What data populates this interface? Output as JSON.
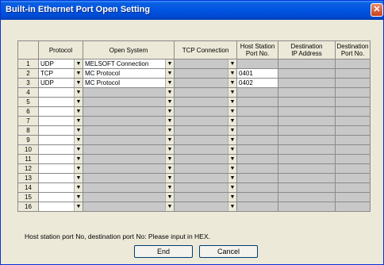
{
  "window": {
    "title": "Built-in Ethernet Port Open Setting"
  },
  "columns": {
    "protocol": "Protocol",
    "open_system": "Open System",
    "tcp_connection": "TCP Connection",
    "host_station_port": "Host Station\nPort No.",
    "dest_ip": "Destination\nIP Address",
    "dest_port": "Destination\nPort No."
  },
  "rows": [
    {
      "num": "1",
      "protocol": "UDP",
      "open_system": "MELSOFT Connection",
      "tcp": "",
      "host_port": "",
      "dest_ip": "",
      "dest_port": ""
    },
    {
      "num": "2",
      "protocol": "TCP",
      "open_system": "MC Protocol",
      "tcp": "",
      "host_port": "0401",
      "dest_ip": "",
      "dest_port": ""
    },
    {
      "num": "3",
      "protocol": "UDP",
      "open_system": "MC Protocol",
      "tcp": "",
      "host_port": "0402",
      "dest_ip": "",
      "dest_port": ""
    },
    {
      "num": "4",
      "protocol": "",
      "open_system": "",
      "tcp": "",
      "host_port": "",
      "dest_ip": "",
      "dest_port": ""
    },
    {
      "num": "5",
      "protocol": "",
      "open_system": "",
      "tcp": "",
      "host_port": "",
      "dest_ip": "",
      "dest_port": ""
    },
    {
      "num": "6",
      "protocol": "",
      "open_system": "",
      "tcp": "",
      "host_port": "",
      "dest_ip": "",
      "dest_port": ""
    },
    {
      "num": "7",
      "protocol": "",
      "open_system": "",
      "tcp": "",
      "host_port": "",
      "dest_ip": "",
      "dest_port": ""
    },
    {
      "num": "8",
      "protocol": "",
      "open_system": "",
      "tcp": "",
      "host_port": "",
      "dest_ip": "",
      "dest_port": ""
    },
    {
      "num": "9",
      "protocol": "",
      "open_system": "",
      "tcp": "",
      "host_port": "",
      "dest_ip": "",
      "dest_port": ""
    },
    {
      "num": "10",
      "protocol": "",
      "open_system": "",
      "tcp": "",
      "host_port": "",
      "dest_ip": "",
      "dest_port": ""
    },
    {
      "num": "11",
      "protocol": "",
      "open_system": "",
      "tcp": "",
      "host_port": "",
      "dest_ip": "",
      "dest_port": ""
    },
    {
      "num": "12",
      "protocol": "",
      "open_system": "",
      "tcp": "",
      "host_port": "",
      "dest_ip": "",
      "dest_port": ""
    },
    {
      "num": "13",
      "protocol": "",
      "open_system": "",
      "tcp": "",
      "host_port": "",
      "dest_ip": "",
      "dest_port": ""
    },
    {
      "num": "14",
      "protocol": "",
      "open_system": "",
      "tcp": "",
      "host_port": "",
      "dest_ip": "",
      "dest_port": ""
    },
    {
      "num": "15",
      "protocol": "",
      "open_system": "",
      "tcp": "",
      "host_port": "",
      "dest_ip": "",
      "dest_port": ""
    },
    {
      "num": "16",
      "protocol": "",
      "open_system": "",
      "tcp": "",
      "host_port": "",
      "dest_ip": "",
      "dest_port": ""
    }
  ],
  "note": "Host station port No, destination port No: Please input in HEX.",
  "buttons": {
    "end": "End",
    "cancel": "Cancel"
  },
  "icons": {
    "close": "close-icon",
    "dropdown": "dropdown-arrow-icon"
  },
  "colors": {
    "titlebar": "#0054e3",
    "dialog_bg": "#ece9d8",
    "disabled_cell": "#c8c8c8",
    "active_cell": "#ffffff"
  }
}
